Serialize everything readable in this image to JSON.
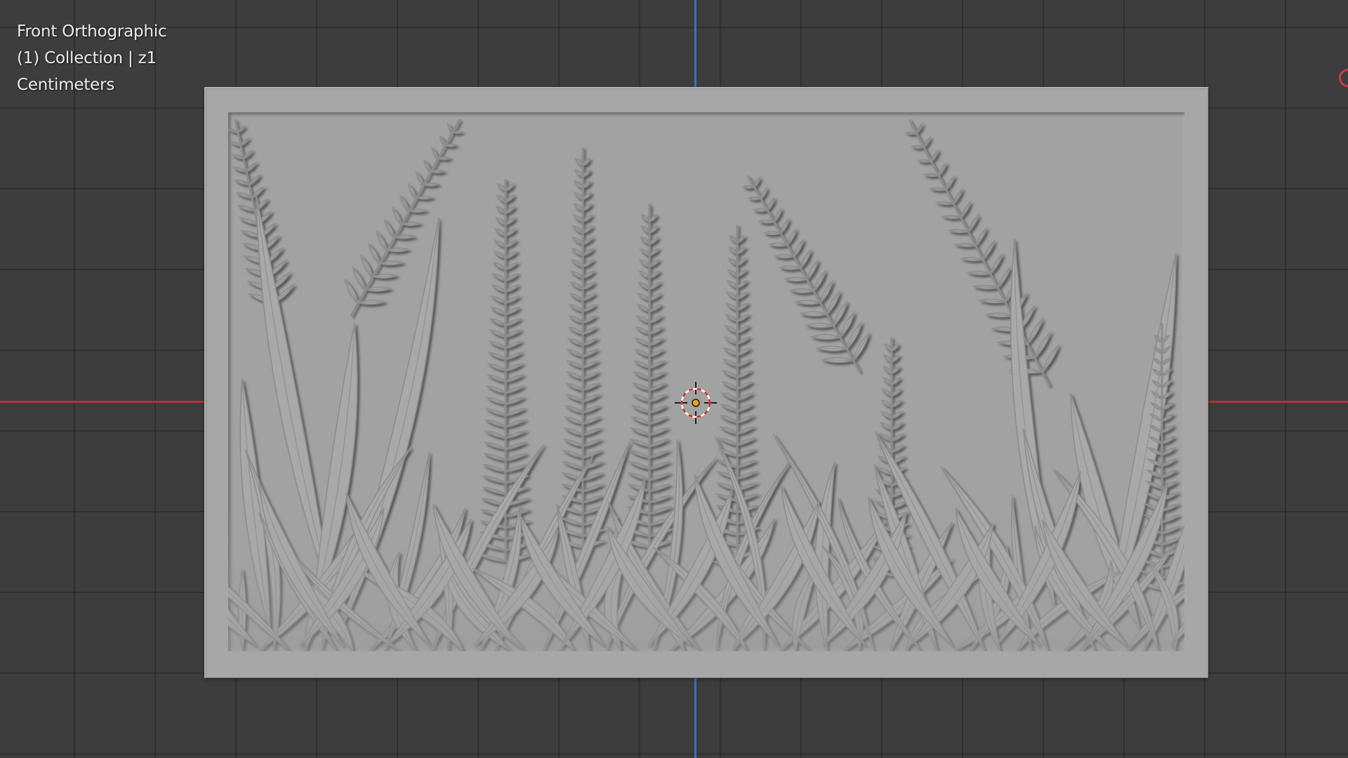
{
  "viewport": {
    "view_name": "Front Orthographic",
    "collection_info": "(1) Collection | z1",
    "units": "Centimeters"
  },
  "colors": {
    "background": "#3d3d3d",
    "x_axis": "#b0333c",
    "z_axis": "#3c6ec8",
    "mesh": "#a2a2a2",
    "cursor_red": "#d42a2a",
    "origin_orange": "#f0a020"
  },
  "icons": {
    "cursor": "3d-cursor-icon",
    "origin": "object-origin-icon",
    "gizmo": "navigation-gizmo-icon"
  }
}
